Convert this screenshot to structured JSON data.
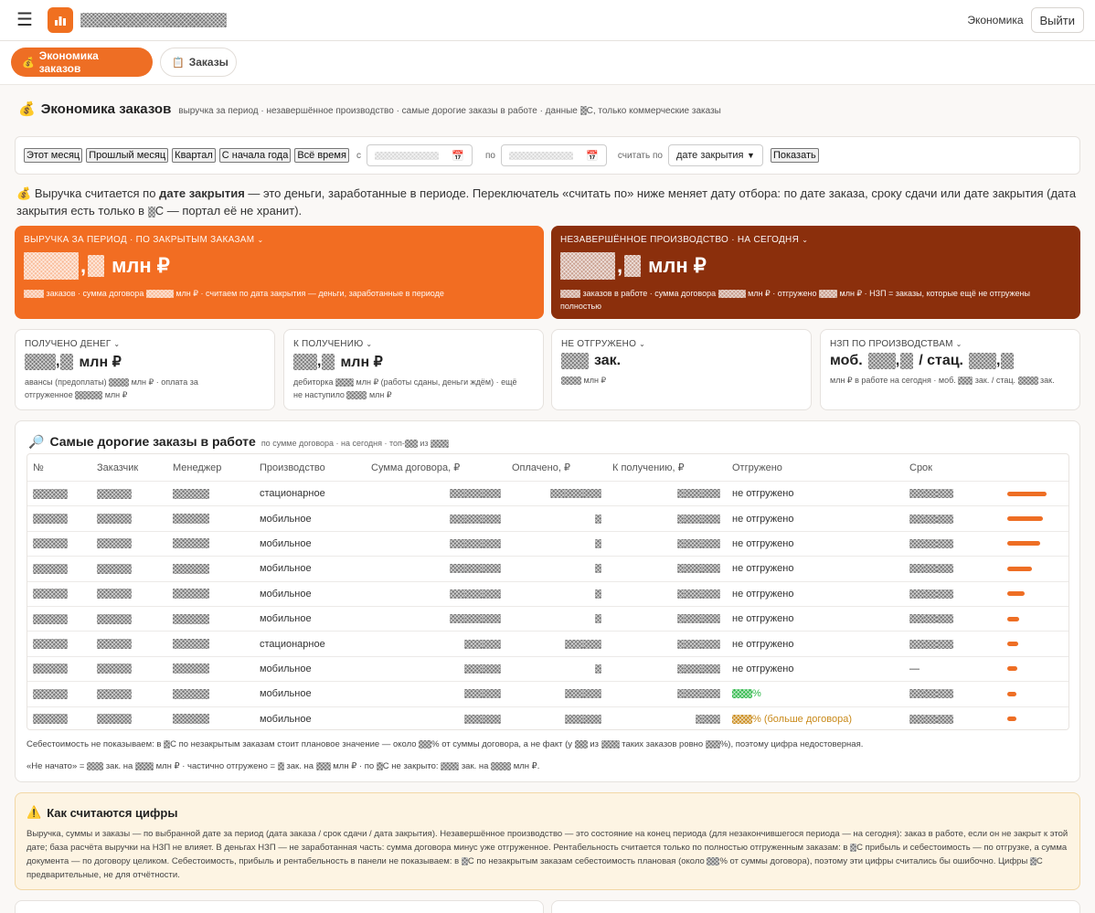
{
  "topbar": {
    "logout_label": "Выйти",
    "economy_link": "Экономика"
  },
  "nav": {
    "tab_active": "Экономика заказов",
    "tab_orders": "Заказы"
  },
  "header": {
    "title": "Экономика заказов",
    "subtitle_1": "выручка за период · незавершённое производство · самые дорогие заказы в работе · данные ",
    "subtitle_2": "С, только коммерческие заказы"
  },
  "filter": {
    "buttons": [
      "Этот месяц",
      "Прошлый месяц",
      "Квартал",
      "С начала года",
      "Всё время"
    ],
    "from_label": "с",
    "to_label": "по",
    "count_by_label": "считать по",
    "count_by_value": "дате закрытия",
    "show_button": "Показать"
  },
  "note": {
    "part1": "Выручка считается по ",
    "bold": "дате закрытия",
    "part2": " — это деньги, заработанные в периоде. Переключатель «считать по» ниже меняет дату отбора: по дате заказа, сроку сдачи или дате закрытия (дата закрытия есть только в ",
    "part3": "С — портал её не хранит)."
  },
  "card_revenue": {
    "label": "ВЫРУЧКА ЗА ПЕРИОД · ПО ЗАКРЫТЫМ ЗАКАЗАМ",
    "value_suffix": ",",
    "unit": "млн ₽",
    "d1": "заказов · сумма договора ",
    "d2": "млн ₽ · считаем по дата закрытия — деньги, заработанные в периоде"
  },
  "card_wip": {
    "label": "НЕЗАВЕРШЁННОЕ ПРОИЗВОДСТВО · НА СЕГОДНЯ",
    "value_suffix": ",",
    "unit": "млн ₽",
    "d1": "заказов в работе · сумма договора ",
    "d2": "млн ₽ · отгружено ",
    "d3": "млн ₽ · НЗП = заказы, которые ещё не отгружены полностью"
  },
  "cards": {
    "received": {
      "label": "ПОЛУЧЕНО ДЕНЕГ",
      "unit": "млн ₽",
      "d1": "авансы (предоплаты) ",
      "d2": "млн ₽ · оплата за",
      "d3": "отгруженное ",
      "d4": "млн ₽"
    },
    "receivable": {
      "label": "К ПОЛУЧЕНИЮ",
      "unit": "млн ₽",
      "d1": "дебиторка ",
      "d2": "млн ₽ (работы сданы, деньги ждём) · ещё",
      "d3": "не наступило ",
      "d4": "млн ₽"
    },
    "not_shipped": {
      "label": "НЕ ОТГРУЖЕНО",
      "unit": "зак.",
      "d1": "млн ₽"
    },
    "wip_by_prod": {
      "label": "НЗП ПО ПРОИЗВОДСТВАМ",
      "mob": "моб.",
      "stat": "/ стац.",
      "d1": "млн ₽ в работе на сегодня · моб. ",
      "d2": "зак. / стац. ",
      "d3": "зак."
    }
  },
  "top_orders": {
    "title": "Самые дорогие заказы в работе",
    "subtitle_1": "по сумме договора · на сегодня · топ-",
    "subtitle_2": "из",
    "columns": [
      "№",
      "Заказчик",
      "Менеджер",
      "Производство",
      "Сумма договора, ₽",
      "Оплачено, ₽",
      "К получению, ₽",
      "Отгружено",
      "Срок"
    ],
    "rows": [
      {
        "production": "стационарное",
        "shipped": "не отгружено",
        "bar": 0.86
      },
      {
        "production": "мобильное",
        "shipped": "не отгружено",
        "bar": 0.78
      },
      {
        "production": "мобильное",
        "shipped": "не отгружено",
        "bar": 0.72
      },
      {
        "production": "мобильное",
        "shipped": "не отгружено",
        "bar": 0.54
      },
      {
        "production": "мобильное",
        "shipped": "не отгружено",
        "bar": 0.38
      },
      {
        "production": "мобильное",
        "shipped": "не отгружено",
        "bar": 0.26
      },
      {
        "production": "стационарное",
        "shipped": "не отгружено",
        "bar": 0.24
      },
      {
        "production": "мобильное",
        "shipped": "не отгружено",
        "bar": 0.22
      },
      {
        "production": "мобильное",
        "shipped": "%",
        "bar": 0.2
      },
      {
        "production": "мобильное",
        "shipped": "% (больше договора)",
        "bar": 0.2
      }
    ],
    "deadline_dash": "—",
    "foot1_a": "Себестоимость не показываем: в ",
    "foot1_b": "С по незакрытым заказам стоит плановое значение — около ",
    "foot1_c": "% от суммы договора, а не факт (у ",
    "foot1_d": "из ",
    "foot1_e": "таких заказов ровно ",
    "foot1_f": "%), поэтому цифра недостоверная.",
    "foot2_a": "«Не начато» = ",
    "foot2_b": "зак. на ",
    "foot2_c": "млн ₽ · частично отгружено = ",
    "foot2_d": "зак. на ",
    "foot2_e": "млн ₽ · по ",
    "foot2_f": "С не закрыто: ",
    "foot2_g": "зак. на ",
    "foot2_h": "млн ₽."
  },
  "how": {
    "title": "Как считаются цифры",
    "t1": "Выручка, суммы и заказы — по выбранной дате за период (дата заказа / срок сдачи / дата закрытия). Незавершённое производство — это состояние на конец периода (для незакончившегося периода — на сегодня): заказ в работе, если он не закрыт к этой дате; база расчёта выручки на НЗП не влияет. В деньгах НЗП — не заработанная часть: сумма договора минус уже отгруженное. Рентабельность считается только по полностью отгруженным заказам: в ",
    "t2": "С прибыль и себестоимость — по отгрузке, а сумма документа — по договору целиком. Себестоимость, прибыль и рентабельность в панели не показываем: в ",
    "t3": "С по незакрытым заказам себестоимость плановая (около ",
    "t4": "% от суммы договора), поэтому эти цифры считались бы ошибочно. Цифры ",
    "t5": "С предварительные, не для отчётности."
  },
  "colors": {
    "accent": "#ee6e24",
    "wip": "#8b2f0c",
    "green": "#2fb84a",
    "gold": "#c98a1a"
  }
}
